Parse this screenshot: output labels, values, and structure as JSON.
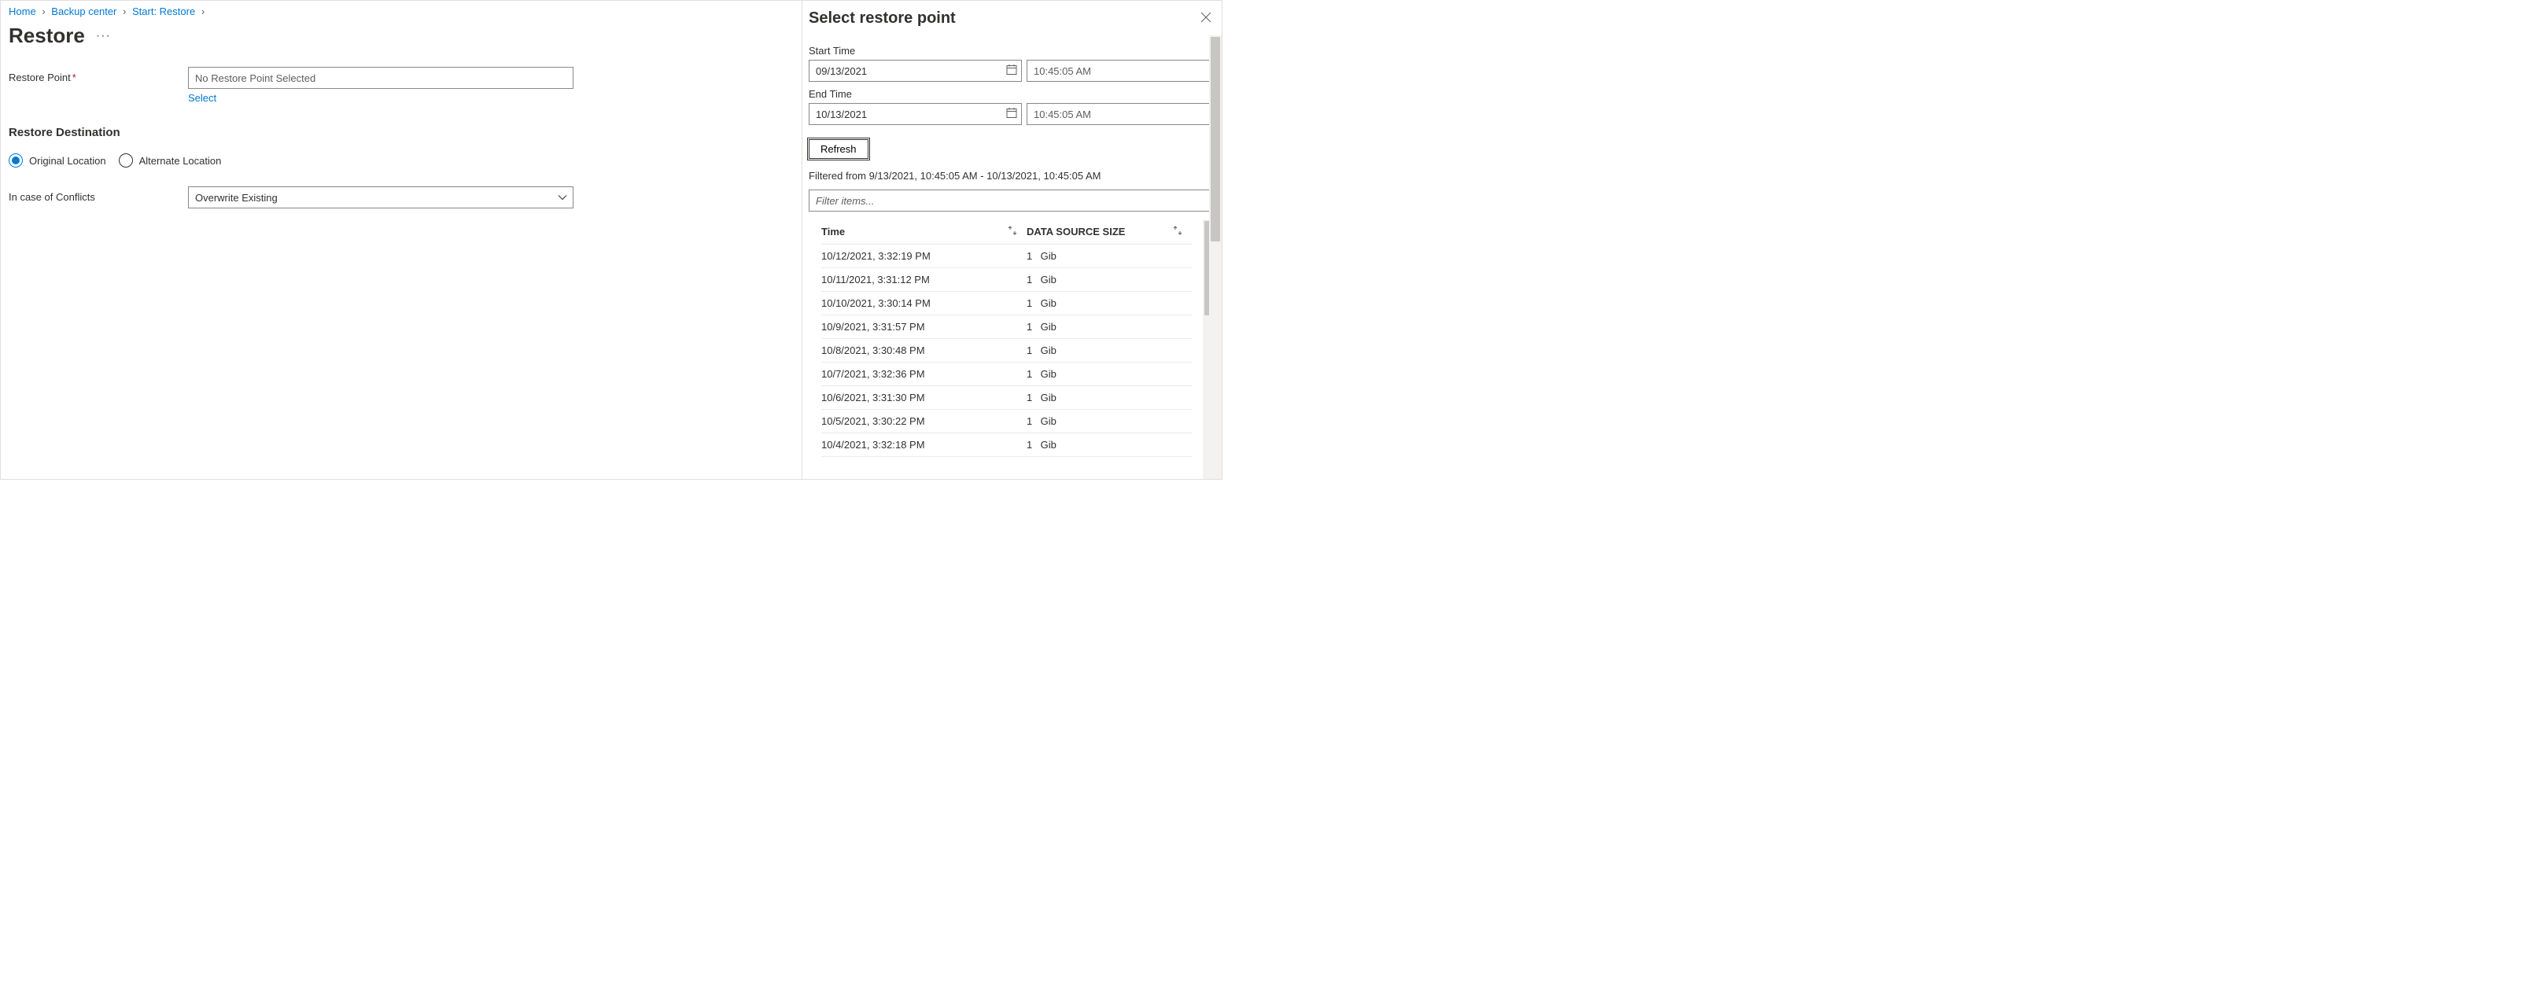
{
  "breadcrumb": {
    "items": [
      "Home",
      "Backup center",
      "Start: Restore"
    ]
  },
  "page": {
    "title": "Restore",
    "restorePoint": {
      "label": "Restore Point",
      "value": "No Restore Point Selected",
      "selectLink": "Select"
    },
    "destination": {
      "heading": "Restore Destination",
      "option1": "Original Location",
      "option2": "Alternate Location"
    },
    "conflicts": {
      "label": "In case of Conflicts",
      "value": "Overwrite Existing"
    }
  },
  "panel": {
    "title": "Select restore point",
    "startTimeLabel": "Start Time",
    "startDate": "09/13/2021",
    "startTime": "10:45:05 AM",
    "endTimeLabel": "End Time",
    "endDate": "10/13/2021",
    "endTime": "10:45:05 AM",
    "refresh": "Refresh",
    "filteredText": "Filtered from 9/13/2021, 10:45:05 AM - 10/13/2021, 10:45:05 AM",
    "filterPlaceholder": "Filter items...",
    "columns": {
      "time": "Time",
      "size": "DATA SOURCE SIZE"
    },
    "rows": [
      {
        "time": "10/12/2021, 3:32:19 PM",
        "num": "1",
        "unit": "Gib"
      },
      {
        "time": "10/11/2021, 3:31:12 PM",
        "num": "1",
        "unit": "Gib"
      },
      {
        "time": "10/10/2021, 3:30:14 PM",
        "num": "1",
        "unit": "Gib"
      },
      {
        "time": "10/9/2021, 3:31:57 PM",
        "num": "1",
        "unit": "Gib"
      },
      {
        "time": "10/8/2021, 3:30:48 PM",
        "num": "1",
        "unit": "Gib"
      },
      {
        "time": "10/7/2021, 3:32:36 PM",
        "num": "1",
        "unit": "Gib"
      },
      {
        "time": "10/6/2021, 3:31:30 PM",
        "num": "1",
        "unit": "Gib"
      },
      {
        "time": "10/5/2021, 3:30:22 PM",
        "num": "1",
        "unit": "Gib"
      },
      {
        "time": "10/4/2021, 3:32:18 PM",
        "num": "1",
        "unit": "Gib"
      }
    ]
  }
}
